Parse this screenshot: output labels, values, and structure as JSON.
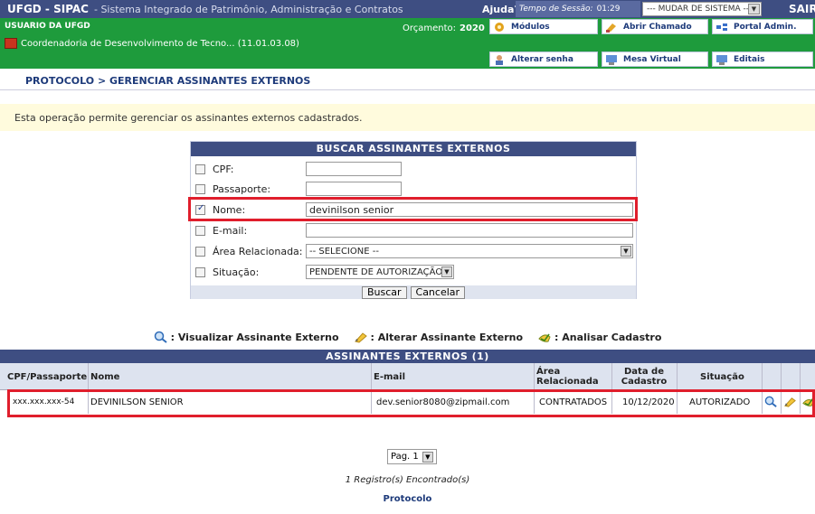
{
  "header": {
    "brand": "UFGD - SIPAC",
    "subtitle": "- Sistema Integrado de Patrimônio, Administração e Contratos",
    "help": "Ajuda?",
    "session_label": "Tempo de Sessão:",
    "session_time": "01:29",
    "switch_system": "--- MUDAR DE SISTEMA ---",
    "logout": "SAIR"
  },
  "userbar": {
    "user": "USUARIO DA UFGD",
    "unit": "Coordenadoria de Desenvolvimento de Tecno... (11.01.03.08)",
    "budget_label": "Orçamento:",
    "budget_year": "2020",
    "menu": [
      {
        "label": "Módulos",
        "icon": "modules-icon"
      },
      {
        "label": "Abrir Chamado",
        "icon": "ticket-icon"
      },
      {
        "label": "Portal Admin.",
        "icon": "portal-icon"
      },
      {
        "label": "Alterar senha",
        "icon": "password-icon"
      },
      {
        "label": "Mesa Virtual",
        "icon": "virtual-desk-icon"
      },
      {
        "label": "Editais",
        "icon": "notices-icon"
      }
    ]
  },
  "breadcrumb": "PROTOCOLO > GERENCIAR ASSINANTES EXTERNOS",
  "info": "Esta operação permite gerenciar os assinantes externos cadastrados.",
  "search": {
    "caption": "BUSCAR ASSINANTES EXTERNOS",
    "fields": {
      "cpf": {
        "label": "CPF:",
        "value": "",
        "checked": false
      },
      "passport": {
        "label": "Passaporte:",
        "value": "",
        "checked": false
      },
      "name": {
        "label": "Nome:",
        "value": "devinilson senior",
        "checked": true
      },
      "email": {
        "label": "E-mail:",
        "value": "",
        "checked": false
      },
      "area": {
        "label": "Área Relacionada:",
        "value": "-- SELECIONE --",
        "checked": false
      },
      "status": {
        "label": "Situação:",
        "value": "PENDENTE DE AUTORIZAÇÃO",
        "checked": false
      }
    },
    "buttons": {
      "search": "Buscar",
      "cancel": "Cancelar"
    }
  },
  "legend": {
    "view": ": Visualizar Assinante Externo",
    "edit": ": Alterar Assinante Externo",
    "analyze": ": Analisar Cadastro"
  },
  "results": {
    "caption": "ASSINANTES EXTERNOS (1)",
    "columns": {
      "doc": "CPF/Passaporte",
      "name": "Nome",
      "email": "E-mail",
      "area": "Área Relacionada",
      "date": "Data de Cadastro",
      "status": "Situação"
    },
    "rows": [
      {
        "doc": "xxx.xxx.xxx-54",
        "name": "DEVINILSON SENIOR",
        "email": "dev.senior8080@zipmail.com",
        "area": "CONTRATADOS",
        "date": "10/12/2020",
        "status": "AUTORIZADO"
      }
    ]
  },
  "pagination": {
    "label": "Pag. 1"
  },
  "record_count": "1 Registro(s) Encontrado(s)",
  "footer_link": "Protocolo",
  "colors": {
    "header_blue": "#3e4e82",
    "user_green": "#1e9b3c",
    "highlight_red": "#e01e2c",
    "info_yellow": "#fffbdd"
  }
}
